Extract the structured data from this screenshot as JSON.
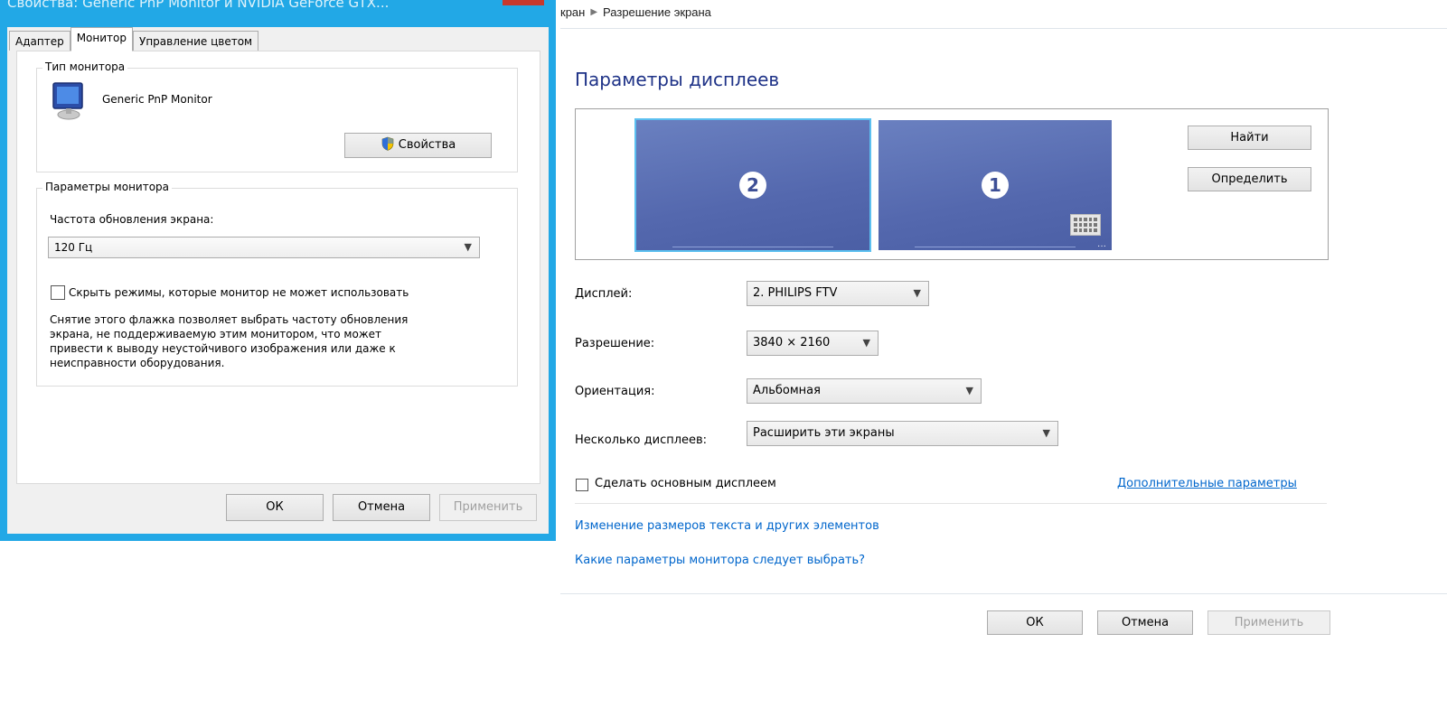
{
  "dialog": {
    "title": "Свойства: Generic PnP Monitor и NVIDIA GeForce GTX...",
    "tabs": [
      {
        "label": "Адаптер"
      },
      {
        "label": "Монитор"
      },
      {
        "label": "Управление цветом"
      }
    ],
    "monitor_type": {
      "group_title": "Тип монитора",
      "monitor_name": "Generic PnP Monitor",
      "properties_button": "Свойства"
    },
    "monitor_settings": {
      "group_title": "Параметры монитора",
      "refresh_label": "Частота обновления экрана:",
      "refresh_value": "120 Гц",
      "hide_modes_label": "Скрыть режимы, которые монитор не может использовать",
      "hide_modes_checked": false,
      "description_lines": [
        "Снятие этого флажка позволяет выбрать частоту обновления",
        "экрана, не поддерживаемую этим монитором, что может",
        "привести к выводу неустойчивого изображения или даже к",
        "неисправности оборудования."
      ]
    },
    "buttons": {
      "ok": "ОК",
      "cancel": "Отмена",
      "apply": "Применить"
    },
    "colors": {
      "frame": "#22a8e6",
      "close": "#c7382d"
    }
  },
  "screen_resolution": {
    "breadcrumb": [
      "кран",
      "Разрешение экрана"
    ],
    "heading": "Параметры дисплеев",
    "monitors": [
      {
        "number": "2",
        "selected": true
      },
      {
        "number": "1",
        "selected": false
      }
    ],
    "find_button": "Найти",
    "identify_button": "Определить",
    "display": {
      "label": "Дисплей:",
      "value": "2. PHILIPS FTV"
    },
    "resolution": {
      "label": "Разрешение:",
      "value": "3840 × 2160"
    },
    "orientation": {
      "label": "Ориентация:",
      "value": "Альбомная"
    },
    "multiple": {
      "label": "Несколько дисплеев:",
      "value": "Расширить эти экраны"
    },
    "make_main_label": "Сделать основным дисплеем",
    "make_main_checked": false,
    "advanced_link": "Дополнительные параметры",
    "link_text_size": "Изменение размеров текста и других элементов",
    "link_which_settings": "Какие параметры монитора следует выбрать?",
    "buttons": {
      "ok": "ОК",
      "cancel": "Отмена",
      "apply": "Применить"
    },
    "colors": {
      "heading": "#1e3287",
      "monitor": "#5468ae",
      "selection": "#5cc0f0",
      "link": "#0066cc"
    }
  }
}
